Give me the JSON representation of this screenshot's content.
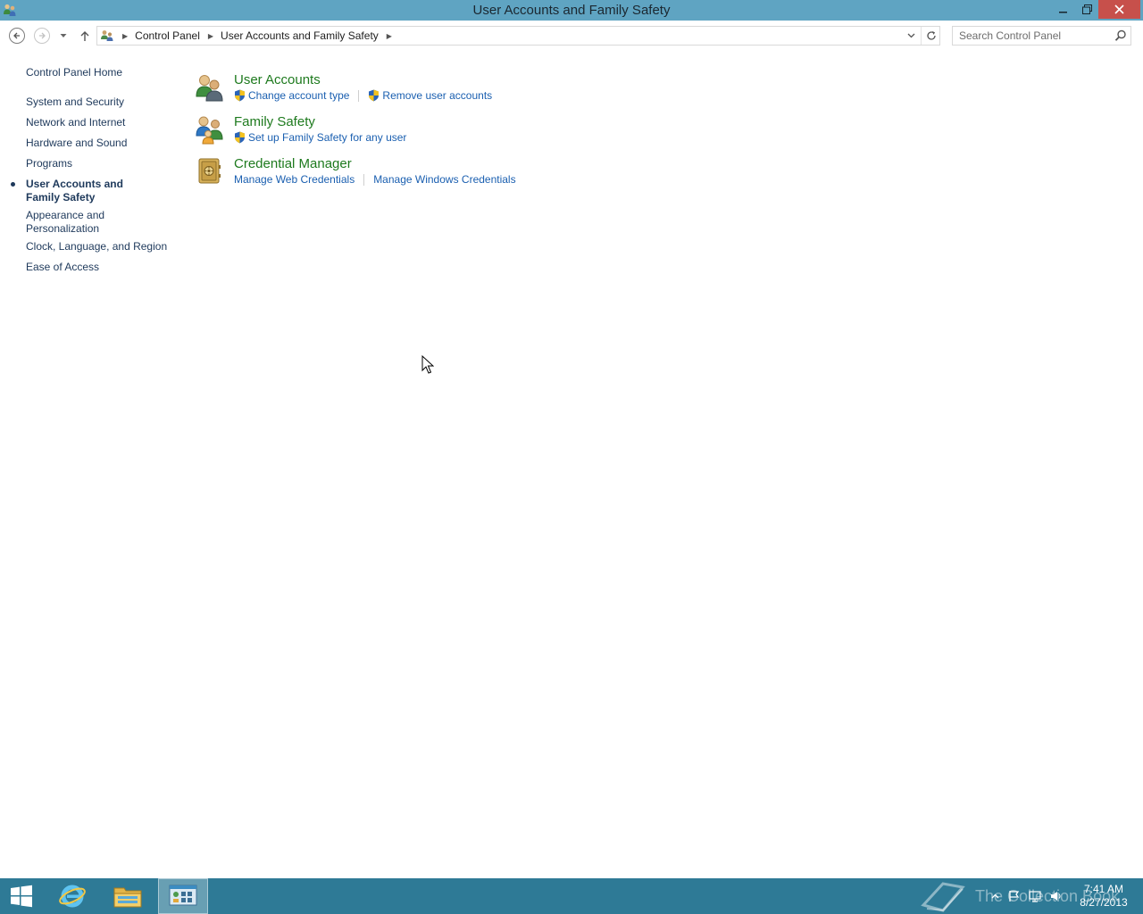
{
  "window": {
    "title": "User Accounts and Family Safety",
    "controls": {
      "minimize": "—",
      "restore": "❐",
      "close": "✕"
    }
  },
  "address_bar": {
    "breadcrumbs": [
      "Control Panel",
      "User Accounts and Family Safety"
    ],
    "search_placeholder": "Search Control Panel"
  },
  "left_nav": {
    "home": "Control Panel Home",
    "items": [
      {
        "label": "System and Security",
        "active": false
      },
      {
        "label": "Network and Internet",
        "active": false
      },
      {
        "label": "Hardware and Sound",
        "active": false
      },
      {
        "label": "Programs",
        "active": false
      },
      {
        "label": "User Accounts and Family Safety",
        "active": true
      },
      {
        "label": "Appearance and Personalization",
        "active": false
      },
      {
        "label": "Clock, Language, and Region",
        "active": false
      },
      {
        "label": "Ease of Access",
        "active": false
      }
    ]
  },
  "categories": [
    {
      "title": "User Accounts",
      "icon": "users-icon",
      "tasks": [
        {
          "label": "Change account type",
          "shield": true
        },
        {
          "label": "Remove user accounts",
          "shield": true
        }
      ]
    },
    {
      "title": "Family Safety",
      "icon": "family-icon",
      "tasks": [
        {
          "label": "Set up Family Safety for any user",
          "shield": true
        }
      ]
    },
    {
      "title": "Credential Manager",
      "icon": "vault-icon",
      "tasks": [
        {
          "label": "Manage Web Credentials",
          "shield": false
        },
        {
          "label": "Manage Windows Credentials",
          "shield": false
        }
      ]
    }
  ],
  "taskbar": {
    "time": "7:41 AM",
    "date": "8/27/2013",
    "watermark": "The Collection Book"
  },
  "colors": {
    "titlebar": "#5fa4c2",
    "taskbar": "#2e7a96",
    "category_title": "#1e7a1e",
    "task_link": "#1a5fb0",
    "nav_link": "#1e395b"
  }
}
